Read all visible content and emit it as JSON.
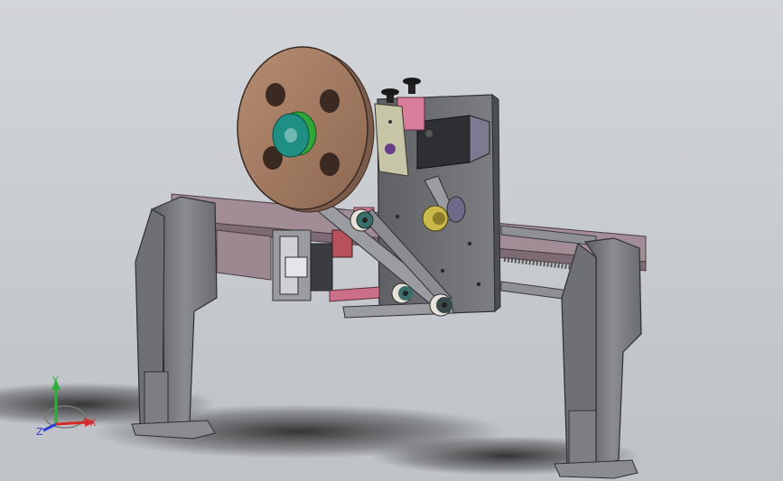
{
  "viewport": {
    "background_top": "#d2d5da",
    "background_bottom": "#bfc2c7"
  },
  "triad": {
    "x_label": "X",
    "y_label": "Y",
    "z_label": "Z",
    "x_color": "#d42a2a",
    "y_color": "#2fae3a",
    "z_color": "#2a3fd0"
  },
  "model": {
    "frame_color": "#76787c",
    "beam_color": "#a28d96",
    "plate_color": "#6a6c70",
    "reel_color": "#a98168",
    "hub_color": "#1f8f84",
    "motor_color": "#2d2f33",
    "accent_pink": "#d97e9a",
    "accent_yellow": "#c9b84a"
  }
}
